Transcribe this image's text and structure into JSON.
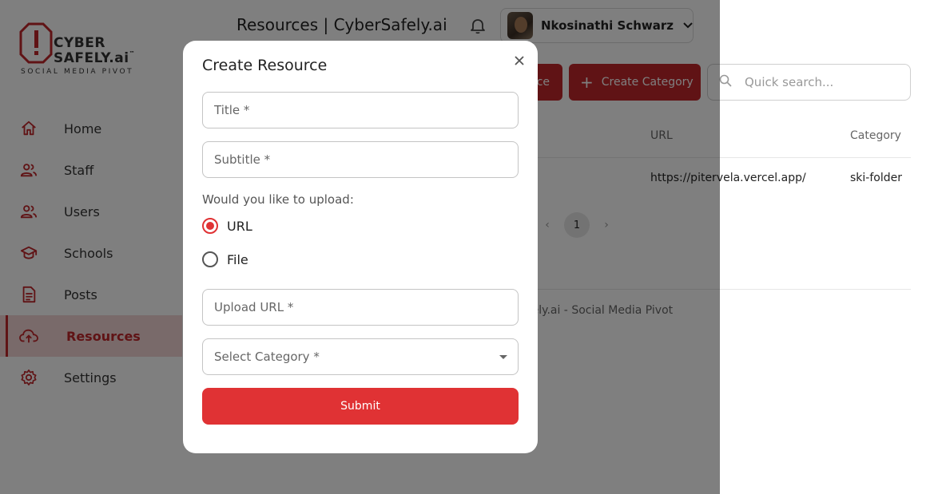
{
  "brand": {
    "line1": "CYBER",
    "line2": "SAFELY.ai",
    "tm": "™",
    "tagline": "SOCIAL MEDIA PIVOT",
    "color": "#c0262b"
  },
  "sidebar": {
    "items": [
      {
        "label": "Home",
        "icon": "home-icon",
        "active": false
      },
      {
        "label": "Staff",
        "icon": "people-icon",
        "active": false
      },
      {
        "label": "Users",
        "icon": "people-icon",
        "active": false
      },
      {
        "label": "Schools",
        "icon": "graduation-cap-icon",
        "active": false
      },
      {
        "label": "Posts",
        "icon": "document-icon",
        "active": false
      },
      {
        "label": "Resources",
        "icon": "cloud-upload-icon",
        "active": true
      },
      {
        "label": "Settings",
        "icon": "gear-icon",
        "active": false
      }
    ]
  },
  "header": {
    "title": "Resources | CyberSafely.ai",
    "user_name": "Nkosinathi Schwarz"
  },
  "toolbar": {
    "create_resource_label": "ce",
    "create_category_label": "Create Category",
    "search_placeholder": "Quick search..."
  },
  "table": {
    "columns": [
      "URL",
      "Category"
    ],
    "rows": [
      {
        "url": "https://pitervela.vercel.app/",
        "category": "ski-folder"
      }
    ]
  },
  "pagination": {
    "current": "1"
  },
  "footer": {
    "text": "berSafely.ai - Social Media Pivot"
  },
  "modal": {
    "title": "Create Resource",
    "title_placeholder": "Title *",
    "subtitle_placeholder": "Subtitle *",
    "upload_question": "Would you like to upload:",
    "options": [
      {
        "label": "URL",
        "checked": true
      },
      {
        "label": "File",
        "checked": false
      }
    ],
    "url_placeholder": "Upload URL *",
    "category_placeholder": "Select Category *",
    "submit_label": "Submit"
  },
  "colors": {
    "accent": "#c0262b",
    "submit": "#e03234",
    "active_bg": "#f3d5d5"
  }
}
